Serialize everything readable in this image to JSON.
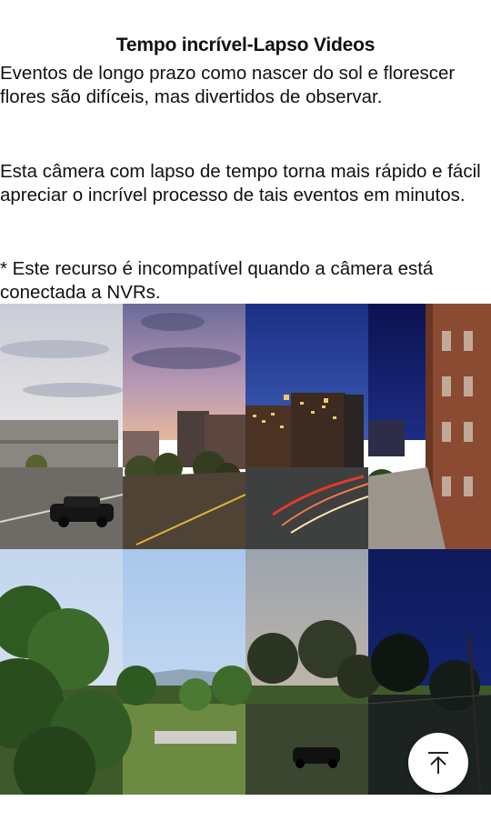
{
  "section": {
    "title": "Tempo incrível-Lapso Videos",
    "paragraph_1": "Eventos de longo prazo como nascer do sol e florescer flores são difíceis, mas divertidos de observar.",
    "paragraph_2": "Esta câmera com lapso de tempo torna mais rápido e fácil apreciar o incrível processo de tais eventos em minutos.",
    "paragraph_3": "* Este recurso é incompatível quando a câmera está conectada a NVRs."
  },
  "images": [
    {
      "icon": "city-timelapse-image"
    },
    {
      "icon": "landscape-timelapse-image"
    }
  ],
  "scroll_top": {
    "icon": "arrow-up-icon"
  },
  "colors": {
    "text": "#111111",
    "background": "#ffffff",
    "night_sky": "#0e1a5c"
  }
}
